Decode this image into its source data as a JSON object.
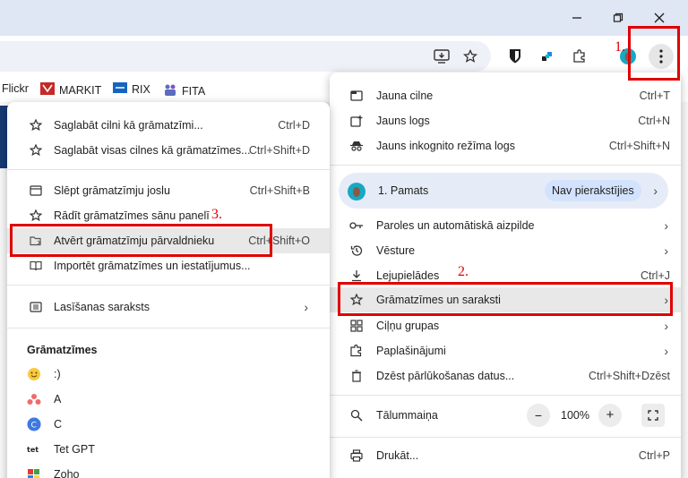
{
  "window": {
    "minimize_icon": "minimize-icon",
    "restore_icon": "restore-icon",
    "close_icon": "close-icon"
  },
  "toolbar": {
    "icons": [
      "install-app-icon",
      "bookmark-star-icon",
      "bitwarden-icon",
      "extension-icon",
      "puzzle-icon",
      "profile-avatar-icon",
      "kebab-menu-icon"
    ]
  },
  "bookmarks_bar": {
    "items": [
      {
        "label": "Flickr"
      },
      {
        "label": "MARKIT"
      },
      {
        "label": "RIX"
      },
      {
        "label": "FITA"
      }
    ]
  },
  "main_menu": {
    "items": [
      {
        "label": "Jauna cilne",
        "shortcut": "Ctrl+T"
      },
      {
        "label": "Jauns logs",
        "shortcut": "Ctrl+N"
      },
      {
        "label": "Jauns inkognito režīma logs",
        "shortcut": "Ctrl+Shift+N"
      }
    ],
    "profile": {
      "label": "1. Pamats",
      "badge": "Nav pierakstījies"
    },
    "items2": [
      {
        "label": "Paroles un automātiskā aizpilde"
      },
      {
        "label": "Vēsture"
      },
      {
        "label": "Lejupielādes",
        "shortcut": "Ctrl+J"
      },
      {
        "label": "Grāmatzīmes un saraksti"
      },
      {
        "label": "Ciļņu grupas"
      },
      {
        "label": "Paplašinājumi"
      },
      {
        "label": "Dzēst pārlūkošanas datus...",
        "shortcut": "Ctrl+Shift+Dzēst"
      }
    ],
    "zoom": {
      "label": "Tālummaiņa",
      "minus": "−",
      "value": "100%",
      "plus": "+"
    },
    "items3": [
      {
        "label": "Drukāt...",
        "shortcut": "Ctrl+P"
      }
    ]
  },
  "sub_menu": {
    "items": [
      {
        "label": "Saglabāt cilni kā grāmatzīmi...",
        "shortcut": "Ctrl+D"
      },
      {
        "label": "Saglabāt visas cilnes kā grāmatzīmes...",
        "shortcut": "Ctrl+Shift+D"
      },
      {
        "label": "Slēpt grāmatzīmju joslu",
        "shortcut": "Ctrl+Shift+B"
      },
      {
        "label": "Rādīt grāmatzīmes sānu panelī"
      },
      {
        "label": "Atvērt grāmatzīmju pārvaldnieku",
        "shortcut": "Ctrl+Shift+O"
      },
      {
        "label": "Importēt grāmatzīmes un iestatījumus..."
      },
      {
        "label": "Lasīšanas saraksts"
      }
    ],
    "section_title": "Grāmatzīmes",
    "bookmarks": [
      {
        "label": ":)"
      },
      {
        "label": "A"
      },
      {
        "label": "C"
      },
      {
        "label": "Tet GPT"
      },
      {
        "label": "Zoho"
      }
    ]
  },
  "annotations": {
    "n1": "1.",
    "n2": "2.",
    "n3": "3.",
    "color": "#e00000"
  }
}
